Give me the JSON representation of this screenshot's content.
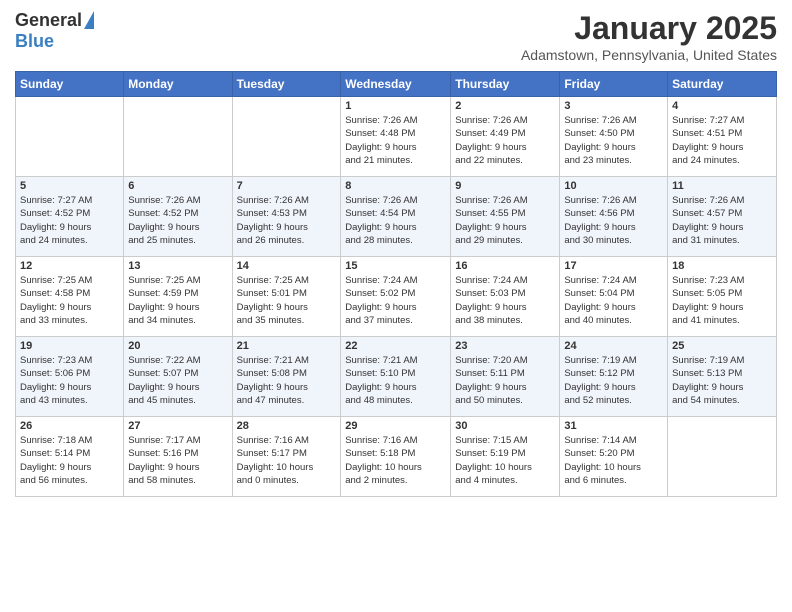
{
  "logo": {
    "general": "General",
    "blue": "Blue"
  },
  "header": {
    "month": "January 2025",
    "location": "Adamstown, Pennsylvania, United States"
  },
  "weekdays": [
    "Sunday",
    "Monday",
    "Tuesday",
    "Wednesday",
    "Thursday",
    "Friday",
    "Saturday"
  ],
  "weeks": [
    [
      {
        "day": "",
        "info": ""
      },
      {
        "day": "",
        "info": ""
      },
      {
        "day": "",
        "info": ""
      },
      {
        "day": "1",
        "info": "Sunrise: 7:26 AM\nSunset: 4:48 PM\nDaylight: 9 hours\nand 21 minutes."
      },
      {
        "day": "2",
        "info": "Sunrise: 7:26 AM\nSunset: 4:49 PM\nDaylight: 9 hours\nand 22 minutes."
      },
      {
        "day": "3",
        "info": "Sunrise: 7:26 AM\nSunset: 4:50 PM\nDaylight: 9 hours\nand 23 minutes."
      },
      {
        "day": "4",
        "info": "Sunrise: 7:27 AM\nSunset: 4:51 PM\nDaylight: 9 hours\nand 24 minutes."
      }
    ],
    [
      {
        "day": "5",
        "info": "Sunrise: 7:27 AM\nSunset: 4:52 PM\nDaylight: 9 hours\nand 24 minutes."
      },
      {
        "day": "6",
        "info": "Sunrise: 7:26 AM\nSunset: 4:52 PM\nDaylight: 9 hours\nand 25 minutes."
      },
      {
        "day": "7",
        "info": "Sunrise: 7:26 AM\nSunset: 4:53 PM\nDaylight: 9 hours\nand 26 minutes."
      },
      {
        "day": "8",
        "info": "Sunrise: 7:26 AM\nSunset: 4:54 PM\nDaylight: 9 hours\nand 28 minutes."
      },
      {
        "day": "9",
        "info": "Sunrise: 7:26 AM\nSunset: 4:55 PM\nDaylight: 9 hours\nand 29 minutes."
      },
      {
        "day": "10",
        "info": "Sunrise: 7:26 AM\nSunset: 4:56 PM\nDaylight: 9 hours\nand 30 minutes."
      },
      {
        "day": "11",
        "info": "Sunrise: 7:26 AM\nSunset: 4:57 PM\nDaylight: 9 hours\nand 31 minutes."
      }
    ],
    [
      {
        "day": "12",
        "info": "Sunrise: 7:25 AM\nSunset: 4:58 PM\nDaylight: 9 hours\nand 33 minutes."
      },
      {
        "day": "13",
        "info": "Sunrise: 7:25 AM\nSunset: 4:59 PM\nDaylight: 9 hours\nand 34 minutes."
      },
      {
        "day": "14",
        "info": "Sunrise: 7:25 AM\nSunset: 5:01 PM\nDaylight: 9 hours\nand 35 minutes."
      },
      {
        "day": "15",
        "info": "Sunrise: 7:24 AM\nSunset: 5:02 PM\nDaylight: 9 hours\nand 37 minutes."
      },
      {
        "day": "16",
        "info": "Sunrise: 7:24 AM\nSunset: 5:03 PM\nDaylight: 9 hours\nand 38 minutes."
      },
      {
        "day": "17",
        "info": "Sunrise: 7:24 AM\nSunset: 5:04 PM\nDaylight: 9 hours\nand 40 minutes."
      },
      {
        "day": "18",
        "info": "Sunrise: 7:23 AM\nSunset: 5:05 PM\nDaylight: 9 hours\nand 41 minutes."
      }
    ],
    [
      {
        "day": "19",
        "info": "Sunrise: 7:23 AM\nSunset: 5:06 PM\nDaylight: 9 hours\nand 43 minutes."
      },
      {
        "day": "20",
        "info": "Sunrise: 7:22 AM\nSunset: 5:07 PM\nDaylight: 9 hours\nand 45 minutes."
      },
      {
        "day": "21",
        "info": "Sunrise: 7:21 AM\nSunset: 5:08 PM\nDaylight: 9 hours\nand 47 minutes."
      },
      {
        "day": "22",
        "info": "Sunrise: 7:21 AM\nSunset: 5:10 PM\nDaylight: 9 hours\nand 48 minutes."
      },
      {
        "day": "23",
        "info": "Sunrise: 7:20 AM\nSunset: 5:11 PM\nDaylight: 9 hours\nand 50 minutes."
      },
      {
        "day": "24",
        "info": "Sunrise: 7:19 AM\nSunset: 5:12 PM\nDaylight: 9 hours\nand 52 minutes."
      },
      {
        "day": "25",
        "info": "Sunrise: 7:19 AM\nSunset: 5:13 PM\nDaylight: 9 hours\nand 54 minutes."
      }
    ],
    [
      {
        "day": "26",
        "info": "Sunrise: 7:18 AM\nSunset: 5:14 PM\nDaylight: 9 hours\nand 56 minutes."
      },
      {
        "day": "27",
        "info": "Sunrise: 7:17 AM\nSunset: 5:16 PM\nDaylight: 9 hours\nand 58 minutes."
      },
      {
        "day": "28",
        "info": "Sunrise: 7:16 AM\nSunset: 5:17 PM\nDaylight: 10 hours\nand 0 minutes."
      },
      {
        "day": "29",
        "info": "Sunrise: 7:16 AM\nSunset: 5:18 PM\nDaylight: 10 hours\nand 2 minutes."
      },
      {
        "day": "30",
        "info": "Sunrise: 7:15 AM\nSunset: 5:19 PM\nDaylight: 10 hours\nand 4 minutes."
      },
      {
        "day": "31",
        "info": "Sunrise: 7:14 AM\nSunset: 5:20 PM\nDaylight: 10 hours\nand 6 minutes."
      },
      {
        "day": "",
        "info": ""
      }
    ]
  ]
}
